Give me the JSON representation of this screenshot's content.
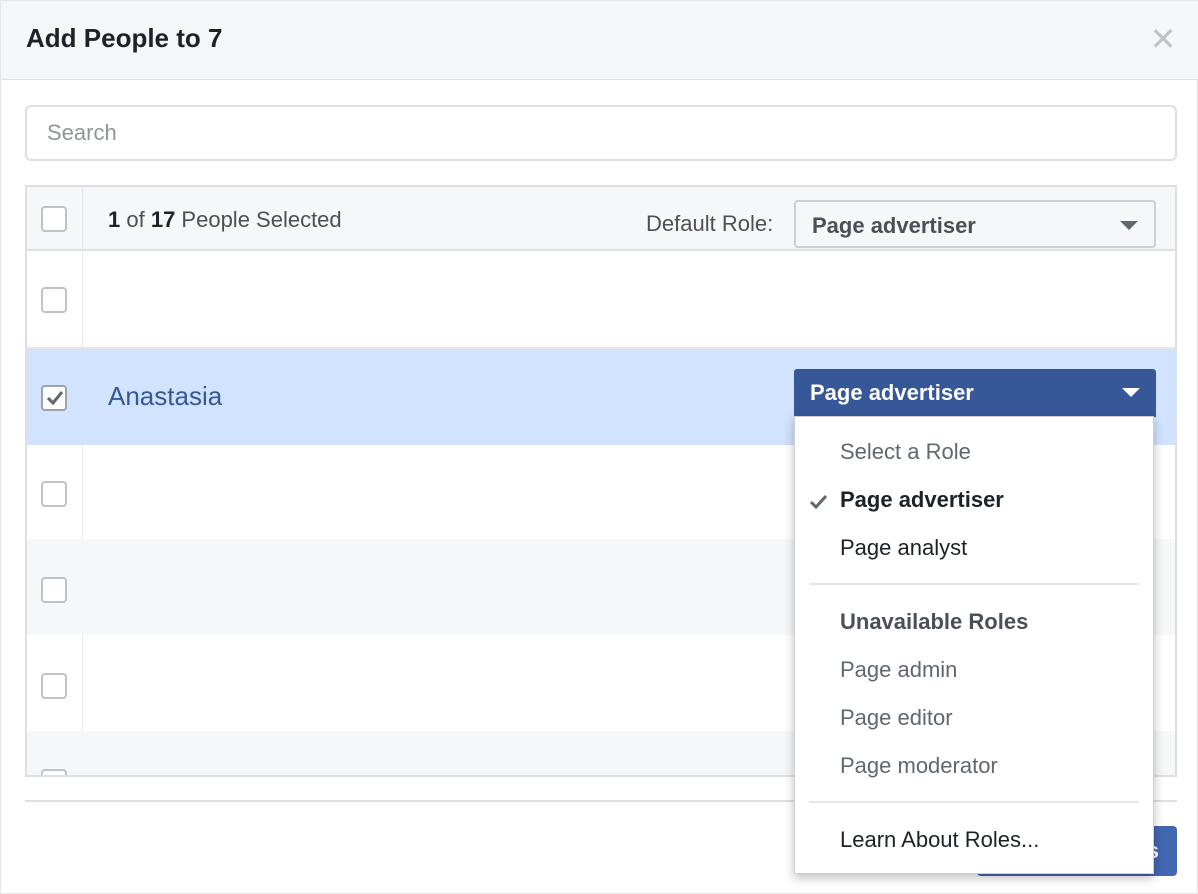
{
  "dialog": {
    "title": "Add People to 7",
    "close_icon": "close-icon"
  },
  "search": {
    "placeholder": "Search",
    "value": ""
  },
  "table_header": {
    "selected_count": "1",
    "of_text": " of ",
    "total_count": "17",
    "suffix": " People Selected",
    "default_role_label": "Default Role:",
    "default_role_value": "Page advertiser"
  },
  "rows": [
    {
      "name": "",
      "checked": false
    },
    {
      "name": "Anastasia",
      "checked": true,
      "role": "Page advertiser"
    },
    {
      "name": "",
      "checked": false
    },
    {
      "name": "",
      "checked": false
    },
    {
      "name": "",
      "checked": false
    }
  ],
  "role_menu": {
    "items": [
      {
        "label": "Select a Role"
      },
      {
        "label": "Page advertiser",
        "selected": true
      },
      {
        "label": "Page analyst"
      }
    ],
    "unavailable_header": "Unavailable Roles",
    "unavailable_items": [
      {
        "label": "Page admin"
      },
      {
        "label": "Page editor"
      },
      {
        "label": "Page moderator"
      }
    ],
    "learn_link": "Learn About Roles..."
  },
  "colors": {
    "accent": "#365899",
    "selected_row": "#d1e3fe",
    "link": "#365899"
  }
}
